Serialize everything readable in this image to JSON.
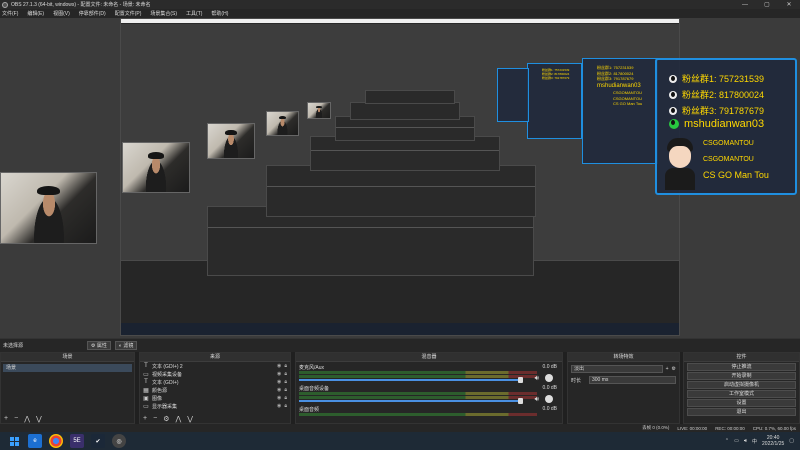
{
  "window": {
    "title": "OBS 27.1.3 (64-bit, windows) - 配置文件: 未命名 - 场景: 未命名",
    "controls": [
      "—",
      "▢",
      "✕"
    ]
  },
  "menu": [
    "文件(F)",
    "编辑(E)",
    "视图(V)",
    "停靠部件(D)",
    "配置文件(P)",
    "场景集合(S)",
    "工具(T)",
    "帮助(H)"
  ],
  "overlay": {
    "fans1": "粉丝群1: 757231539",
    "fans2": "粉丝群2: 817800024",
    "fans3": "粉丝群3: 791787679",
    "wechat": "mshudianwan03",
    "douyin1": "CSGOMANTOU",
    "douyin2": "CSGOMANTOU",
    "brand": "CS GO Man Tou"
  },
  "scene_toolbar": {
    "current_scene": "未选择源",
    "properties": "属性",
    "filters": "滤镜"
  },
  "docks": {
    "scenes": {
      "title": "场景",
      "items": [
        "场景"
      ]
    },
    "sources": {
      "title": "来源",
      "items": [
        {
          "icon": "T",
          "name": "文本 (GDI+) 2"
        },
        {
          "icon": "▭",
          "name": "视频采集设备"
        },
        {
          "icon": "T",
          "name": "文本 (GDI+)"
        },
        {
          "icon": "▦",
          "name": "颜色源"
        },
        {
          "icon": "▣",
          "name": "图像"
        },
        {
          "icon": "▭",
          "name": "显示器采集"
        }
      ]
    },
    "mixer": {
      "title": "混音器",
      "channels": [
        {
          "name": "麦克风/Aux",
          "db": "0.0 dB"
        },
        {
          "name": "桌面音频设备",
          "db": "0.0 dB"
        },
        {
          "name": "桌面音频",
          "db": "0.0 dB"
        }
      ]
    },
    "transitions": {
      "title": "转场特效",
      "type": "淡出",
      "duration_label": "时长",
      "duration": "300 ms"
    },
    "controls": {
      "title": "控件",
      "buttons": [
        "停止推流",
        "开始录制",
        "启动虚拟摄像机",
        "工作室模式",
        "设置",
        "退出"
      ]
    }
  },
  "status": {
    "dropped": "丢帧 0 (0.0%)",
    "live": "LIVE: 00:00:00",
    "rec": "REC: 00:00:00",
    "cpu": "CPU: 0.7%, 60.00 fps"
  },
  "taskbar": {
    "time": "20:40",
    "date": "2022/1/25",
    "lang": "中"
  },
  "colors": {
    "accent": "#1f8fe0",
    "overlay_text": "#ffd800",
    "scene_selected": "#3b4a5b"
  }
}
